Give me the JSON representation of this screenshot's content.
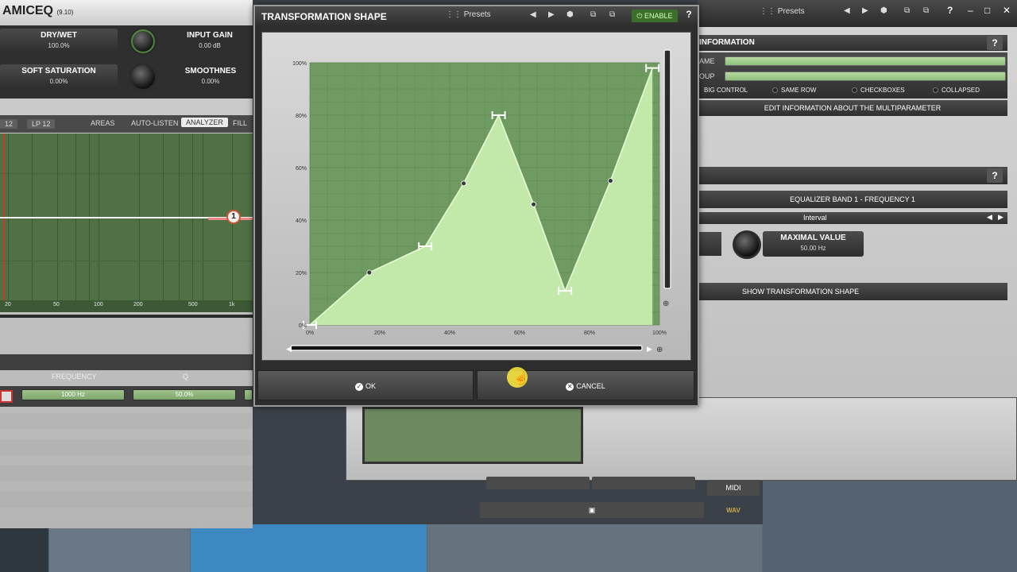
{
  "left_plugin": {
    "title": "AMICEQ",
    "version": "(9.10)",
    "controls": [
      {
        "label": "DRY/WET",
        "value": "100.0%"
      },
      {
        "label": "INPUT GAIN",
        "value": "0.00 dB"
      },
      {
        "label": "SOFT SATURATION",
        "value": "0.00%"
      },
      {
        "label": "SMOOTHNES",
        "value": "0.00%"
      }
    ],
    "toolbar": {
      "b12": "12",
      "lp12": "LP 12",
      "areas": "AREAS",
      "auto_listen": "AUTO-LISTEN",
      "analyzer": "ANALYZER",
      "fill": "FILL"
    },
    "freq_labels": [
      "20",
      "50",
      "100",
      "200",
      "500",
      "1k"
    ],
    "band_marker": "1",
    "band_headers": {
      "frequency": "FREQUENCY",
      "q": "Q"
    },
    "band_values": {
      "frequency": "1000 Hz",
      "q": "50.0%"
    }
  },
  "right_plugin": {
    "presets": "Presets",
    "info_title": "INFORMATION",
    "help": "?",
    "field_labels": {
      "name": "AME",
      "group": "OUP"
    },
    "options": [
      "BIG CONTROL",
      "SAME ROW",
      "CHECKBOXES",
      "COLLAPSED"
    ],
    "edit_info": "EDIT INFORMATION ABOUT THE MULTIPARAMETER",
    "band_param": "EQUALIZER BAND 1 - FREQUENCY 1",
    "interval": "Interval",
    "max_label": "MAXIMAL VALUE",
    "max_value": "50.00 Hz",
    "show_shape": "SHOW TRANSFORMATION SHAPE",
    "midi": "MIDI",
    "wav": "WAV"
  },
  "dialog": {
    "title": "TRANSFORMATION SHAPE",
    "presets": "Presets",
    "enable": "ENABLE",
    "help": "?",
    "ok": "OK",
    "cancel": "CANCEL"
  },
  "chart_data": {
    "type": "area",
    "x_ticks": [
      "0%",
      "20%",
      "40%",
      "60%",
      "80%",
      "100%"
    ],
    "y_ticks": [
      "0%",
      "20%",
      "40%",
      "60%",
      "80%",
      "100%"
    ],
    "xlim": [
      0,
      100
    ],
    "ylim": [
      0,
      100
    ],
    "grid": true,
    "handles": [
      {
        "x": 0,
        "y": 0
      },
      {
        "x": 33,
        "y": 30
      },
      {
        "x": 54,
        "y": 80
      },
      {
        "x": 73,
        "y": 13
      },
      {
        "x": 98,
        "y": 98
      }
    ],
    "curve_points": [
      {
        "x": 0,
        "y": 0
      },
      {
        "x": 17,
        "y": 20
      },
      {
        "x": 33,
        "y": 30
      },
      {
        "x": 44,
        "y": 54
      },
      {
        "x": 54,
        "y": 80
      },
      {
        "x": 64,
        "y": 46
      },
      {
        "x": 73,
        "y": 13
      },
      {
        "x": 86,
        "y": 55
      },
      {
        "x": 98,
        "y": 98
      }
    ],
    "colors": {
      "fill": "#c6ecae",
      "grid": "#5d8a52",
      "bg": "#6f9a62"
    }
  }
}
